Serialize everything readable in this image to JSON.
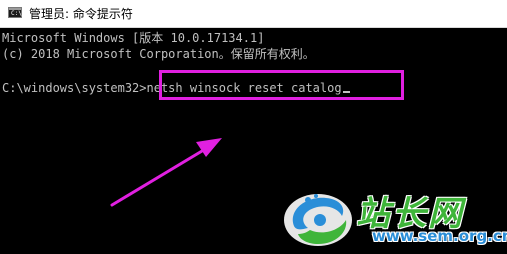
{
  "window": {
    "title": "管理员: 命令提示符",
    "icon_text": "C:\\"
  },
  "console": {
    "lines": [
      "Microsoft Windows [版本 10.0.17134.1]",
      "(c) 2018 Microsoft Corporation。保留所有权利。"
    ],
    "prompt": "C:\\windows\\system32>",
    "command": "netsh winsock reset catalog"
  },
  "annotation": {
    "box_color": "#e020e0",
    "arrow_color": "#e020e0"
  },
  "watermark": {
    "logo_icon": "sem-logo-icon",
    "text": "站长网",
    "url": "www.sem.org.cn"
  }
}
